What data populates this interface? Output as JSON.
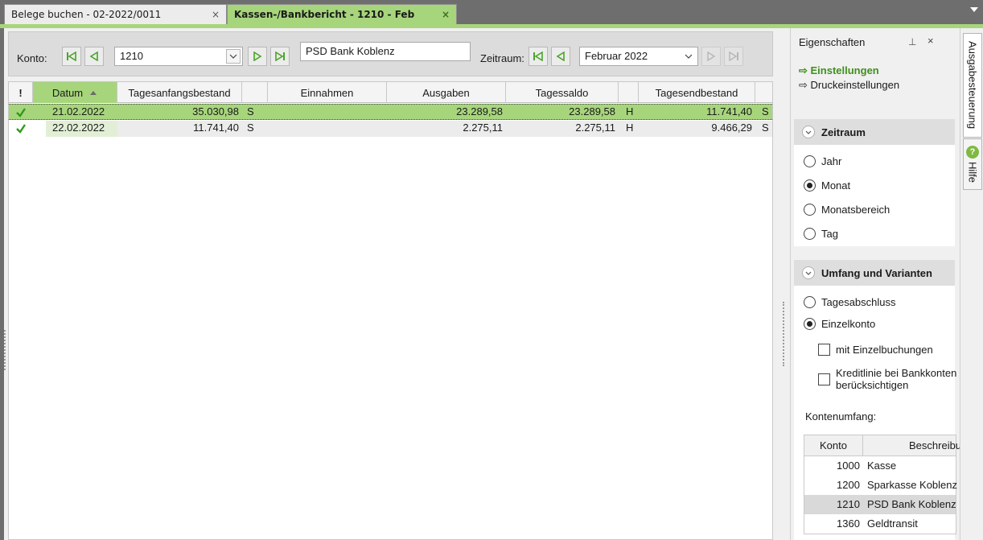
{
  "tabs": [
    {
      "label": "Belege buchen  - 02-2022/0011",
      "close": "×"
    },
    {
      "label": "Kassen-/Bankbericht - 1210 - Feb",
      "close": "×"
    }
  ],
  "toolbar": {
    "konto_label": "Konto:",
    "konto_value": "1210",
    "konto_name": "PSD Bank Koblenz",
    "zeitraum_label": "Zeitraum:",
    "zeitraum_value": "Februar 2022"
  },
  "grid": {
    "columns": [
      "!",
      "Datum",
      "Tagesanfangsbestand",
      "",
      "Einnahmen",
      "Ausgaben",
      "Tagessaldo",
      "",
      "Tagesendbestand",
      ""
    ],
    "rows": [
      {
        "status": "check-icon",
        "datum": "21.02.2022",
        "anfang": "35.030,98",
        "anfang_sh": "S",
        "einnahmen": "",
        "ausgaben": "23.289,58",
        "saldo": "23.289,58",
        "saldo_sh": "H",
        "ende": "11.741,40",
        "ende_sh": "S",
        "selected": true
      },
      {
        "status": "check-icon",
        "datum": "22.02.2022",
        "anfang": "11.741,40",
        "anfang_sh": "S",
        "einnahmen": "",
        "ausgaben": "2.275,11",
        "saldo": "2.275,11",
        "saldo_sh": "H",
        "ende": "9.466,29",
        "ende_sh": "S",
        "selected": false
      }
    ]
  },
  "properties": {
    "title": "Eigenschaften",
    "pin": "⊥",
    "close": "×",
    "link_einstellungen": "⇨ Einstellungen",
    "link_druck": "⇨ Druckeinstellungen",
    "zeitraum_title": "Zeitraum",
    "zeitraum_options": [
      {
        "label": "Jahr",
        "checked": false
      },
      {
        "label": "Monat",
        "checked": true
      },
      {
        "label": "Monatsbereich",
        "checked": false
      },
      {
        "label": "Tag",
        "checked": false
      }
    ],
    "umfang_title": "Umfang und Varianten",
    "umfang_options": [
      {
        "label": "Tagesabschluss",
        "checked": false
      },
      {
        "label": "Einzelkonto",
        "checked": true
      }
    ],
    "chk_einzelbuchungen": "mit Einzelbuchungen",
    "chk_kredit_1": "Kreditlinie bei Bankkonten",
    "chk_kredit_2": "berücksichtigen",
    "kontenumfang_label": "Kontenumfang:",
    "acc_col_konto": "Konto",
    "acc_col_beschr": "Beschreibung",
    "accounts": [
      {
        "konto": "1000",
        "name": "Kasse",
        "selected": false
      },
      {
        "konto": "1200",
        "name": "Sparkasse Koblenz",
        "selected": false
      },
      {
        "konto": "1210",
        "name": "PSD Bank Koblenz",
        "selected": true
      },
      {
        "konto": "1360",
        "name": "Geldtransit",
        "selected": false
      }
    ]
  },
  "sidetabs": {
    "ausgabe": "Ausgabesteuerung",
    "hilfe": "Hilfe",
    "hilfe_icon": "?"
  },
  "colors": {
    "accent": "#a7d57c",
    "link_active": "#3f8f1c",
    "check": "#2e9a1c"
  }
}
